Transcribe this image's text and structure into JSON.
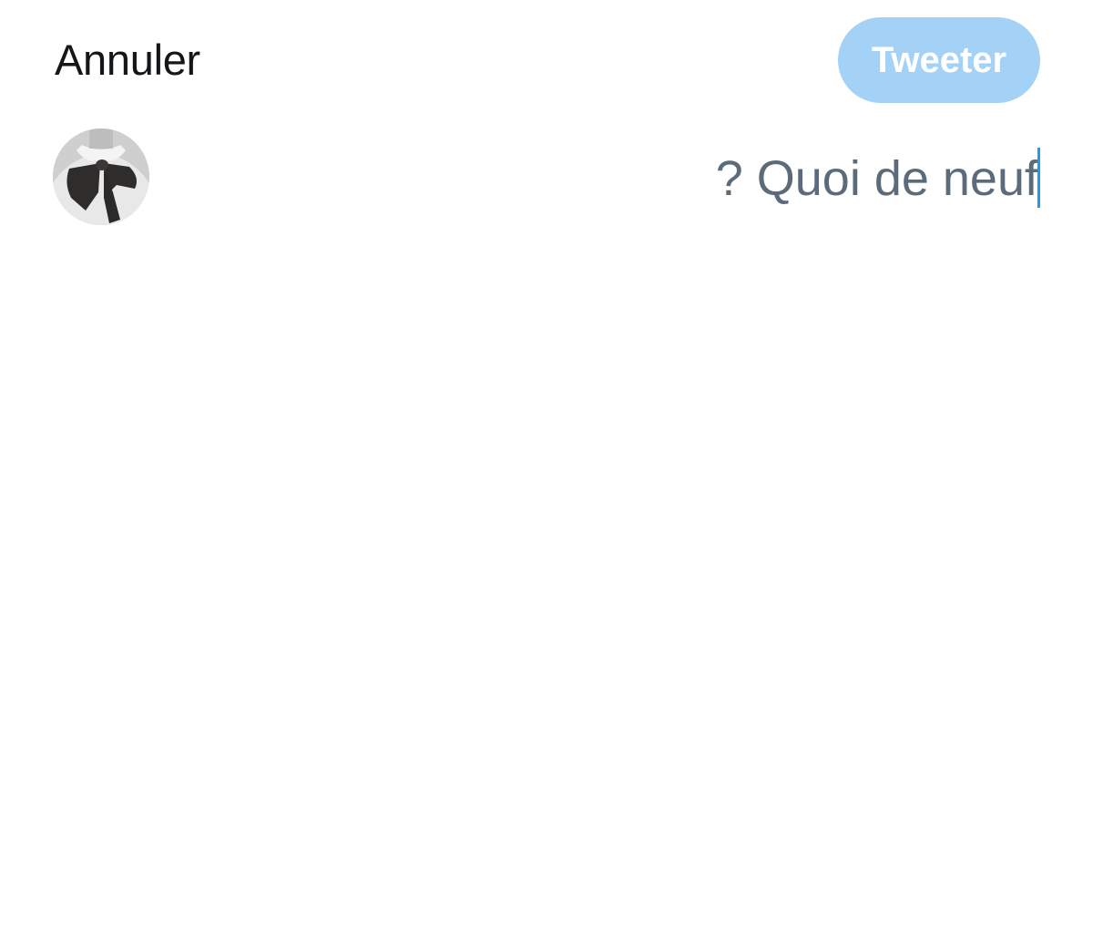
{
  "header": {
    "cancel_label": "Annuler",
    "tweet_label": "Tweeter",
    "tweet_state": "disabled"
  },
  "composer": {
    "placeholder": "? Quoi de neuf",
    "value": ""
  },
  "colors": {
    "accent": "#1d9bf0",
    "tweet_button_disabled": "#9fd0f6",
    "placeholder_text": "#5b6b7a",
    "cancel_text": "#14171a"
  },
  "icons": {
    "avatar": "profile-avatar-image"
  }
}
